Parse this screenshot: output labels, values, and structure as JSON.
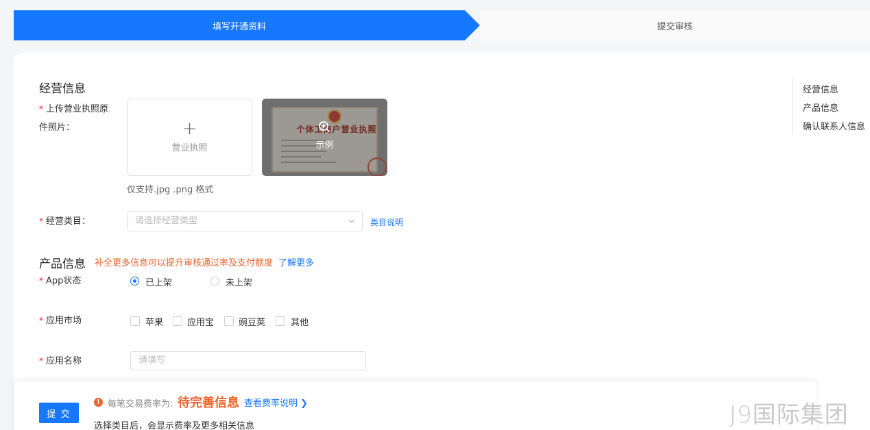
{
  "steps": {
    "active": "填写开通资料",
    "next": "提交审核"
  },
  "business": {
    "title": "经营信息",
    "license_label": "上传营业执照原件照片：",
    "license_label_line1": "上传营业执照原",
    "license_label_line2": "件照片：",
    "upload_plus": "+",
    "upload_text": "营业执照",
    "sample_doc_title": "个体工商户营业执照",
    "sample_label": "示例",
    "format_hint": "仅支持.jpg .png 格式",
    "category_label": "经营类目：",
    "category_placeholder": "请选择经营类型",
    "category_link": "类目说明"
  },
  "product": {
    "title": "产品信息",
    "tip": "补全更多信息可以提升审核通过率及支付额度",
    "tip_link": "了解更多",
    "app_status_label": "App状态",
    "app_status_options": [
      "已上架",
      "未上架"
    ],
    "app_status_selected": "已上架",
    "market_label": "应用市场",
    "market_options": [
      "苹果",
      "应用宝",
      "豌豆荚",
      "其他"
    ],
    "app_name_label": "应用名称",
    "app_name_placeholder": "请填写"
  },
  "anchor_nav": [
    "经营信息",
    "产品信息",
    "确认联系人信息"
  ],
  "footer": {
    "submit_label": "提 交",
    "fee_label": "每笔交易费率为:",
    "fee_value": "待完善信息",
    "fee_link": "查看费率说明 ❯",
    "note": "选择类目后，会显示费率及更多相关信息"
  },
  "watermark": "J9国际集团",
  "colors": {
    "primary": "#1677ff",
    "warning": "#f0622a",
    "required": "#f5222d"
  }
}
